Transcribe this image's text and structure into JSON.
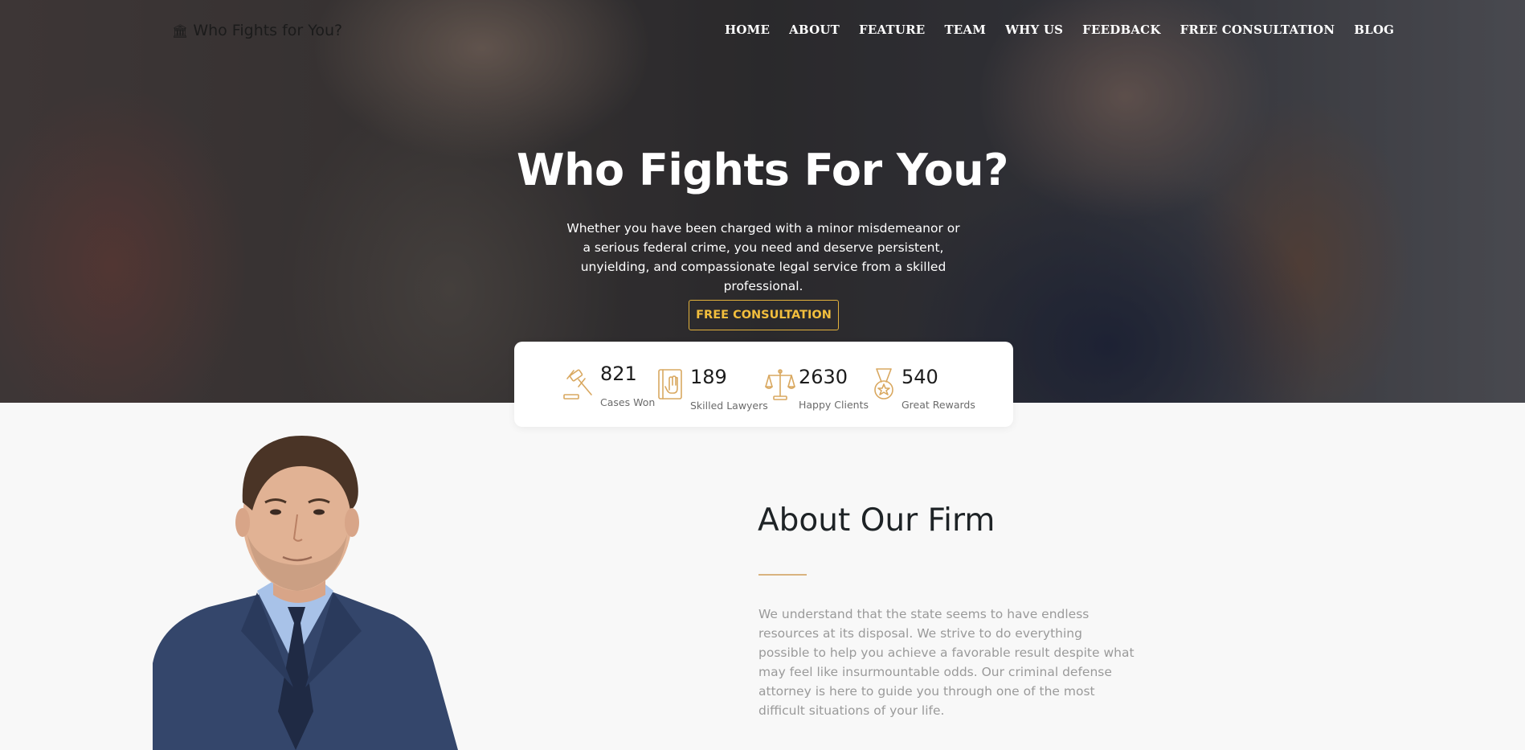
{
  "brand": {
    "icon": "bank-icon",
    "name": "Who Fights for You?"
  },
  "nav": [
    {
      "label": "HOME"
    },
    {
      "label": "ABOUT"
    },
    {
      "label": "FEATURE"
    },
    {
      "label": "TEAM"
    },
    {
      "label": "WHY US"
    },
    {
      "label": "FEEDBACK"
    },
    {
      "label": "FREE CONSULTATION"
    },
    {
      "label": "BLOG"
    }
  ],
  "hero": {
    "title": "Who Fights For You?",
    "subtitle": "Whether you have been charged with a minor misdemeanor or a serious federal crime, you need and deserve persistent, unyielding, and compassionate legal service from a skilled professional.",
    "cta": "FREE CONSULTATION"
  },
  "stats": [
    {
      "icon": "gavel-icon",
      "value": "821",
      "label": "Cases Won"
    },
    {
      "icon": "law-book-icon",
      "value": "189",
      "label": "Skilled Lawyers"
    },
    {
      "icon": "scales-icon",
      "value": "2630",
      "label": "Happy Clients"
    },
    {
      "icon": "medal-icon",
      "value": "540",
      "label": "Great Rewards"
    }
  ],
  "about": {
    "title": "About Our Firm",
    "text": "We understand that the state seems to have endless resources at its disposal. We strive to do everything possible to help you achieve a favorable result despite what may feel like insurmountable odds. Our criminal defense attorney is here to guide you through one of the most difficult situations of your life."
  },
  "colors": {
    "accent": "#f2be3d",
    "icon_gold": "#d9a860",
    "heading": "#1e2326",
    "body_text": "#9a9a9a"
  }
}
